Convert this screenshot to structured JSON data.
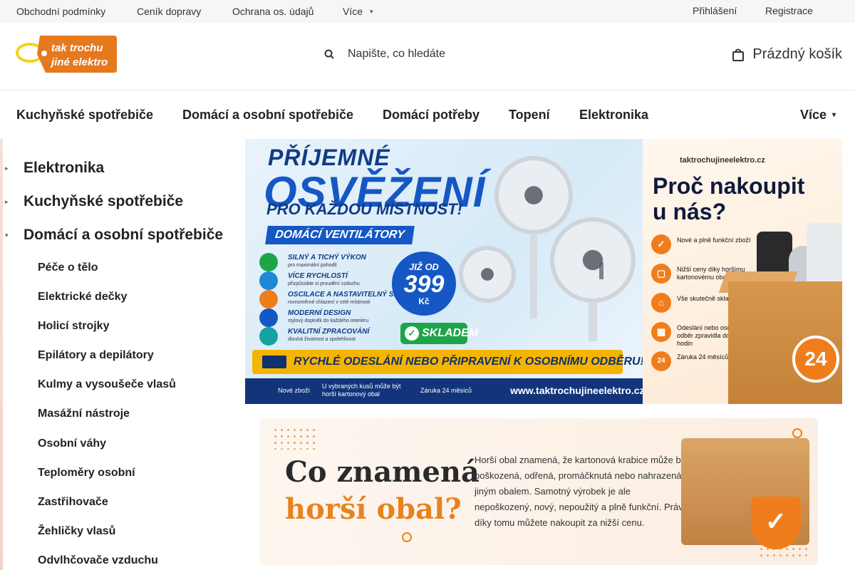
{
  "topbar": {
    "links": [
      "Obchodní podmínky",
      "Ceník dopravy",
      "Ochrana os. údajů",
      "Více"
    ],
    "login": "Přihlášení",
    "register": "Registrace"
  },
  "header": {
    "logo_line1": "tak trochu",
    "logo_line2": "jiné elektro",
    "search_placeholder": "Napište, co hledáte",
    "cart_label": "Prázdný košík"
  },
  "mainnav": {
    "items": [
      "Kuchyňské spotřebiče",
      "Domácí a osobní spotřebiče",
      "Domácí potřeby",
      "Topení",
      "Elektronika"
    ],
    "more": "Více"
  },
  "sidebar": {
    "categories": [
      "Elektronika",
      "Kuchyňské spotřebiče",
      "Domácí a osobní spotřebiče"
    ],
    "subcategories": [
      "Péče o tělo",
      "Elektrické dečky",
      "Holicí strojky",
      "Epilátory a depilátory",
      "Kulmy a vysoušeče vlasů",
      "Masážní nástroje",
      "Osobní váhy",
      "Teploměry osobní",
      "Zastřihovače",
      "Žehličky vlasů",
      "Odvlhčovače vzduchu"
    ]
  },
  "banner_fans": {
    "title1": "PŘÍJEMNÉ",
    "title2": "OSVĚŽENÍ",
    "title3": "PRO KAŽDOU MÍSTNOST!",
    "tag": "DOMÁCÍ VENTILÁTORY",
    "features": [
      {
        "title": "SILNÝ A TICHÝ VÝKON",
        "sub": "pro maximální pohodlí",
        "color": "#1ea44a"
      },
      {
        "title": "VÍCE RYCHLOSTÍ",
        "sub": "přizpůsobte si proudění vzduchu",
        "color": "#1e88d8"
      },
      {
        "title": "OSCILACE A NASTAVITELNÝ SKLON",
        "sub": "rovnoměrné chlazení v celé místnosti",
        "color": "#f07d1c"
      },
      {
        "title": "MODERNÍ DESIGN",
        "sub": "stylový doplněk do každého interiéru",
        "color": "#1557c4"
      },
      {
        "title": "KVALITNÍ ZPRACOVÁNÍ",
        "sub": "dlouhá životnost a spolehlivost",
        "color": "#17a2a2"
      }
    ],
    "price_prefix": "JIŽ OD",
    "price": "399",
    "price_unit": "Kč",
    "stock": "SKLADEM",
    "shipping": "RYCHLÉ ODESLÁNÍ NEBO PŘIPRAVENÍ K OSOBNÍMU ODBĚRU!",
    "foot_new": "Nové zboží",
    "foot_box": "U vybraných kusů může být horší kartonový obal",
    "foot_warranty": "Záruka 24 měsíců",
    "foot_web": "www.taktrochujineelektro.cz"
  },
  "banner_why": {
    "brand": "taktrochujineelektro.cz",
    "title_line1": "Proč nakoupit",
    "title_line2": "u nás?",
    "rows": [
      "Nové a plně funkční zboží",
      "Nižší ceny díky horšímu kartonovému obalu",
      "Vše skutečně skladem",
      "Odeslání nebo osobní odběr zpravidla do 24 hodin",
      "Záruka 24 měsíců"
    ],
    "badge": "24"
  },
  "banner_box": {
    "title_line1": "Co znamená",
    "title_line2": "horší obal?",
    "text": "Horší obal znamená, že kartonová krabice může být poškozená, odřená, promáčknutá nebo nahrazená jiným obalem. Samotný výrobek je ale nepoškozený, nový, nepoužitý a plně funkční. Právě díky tomu můžete nakoupit za nižší cenu."
  },
  "colors": {
    "accent_orange": "#f07d1c",
    "brand_blue": "#1557c4",
    "logo_yellow": "#f4d21f",
    "logo_orange": "#e6781e"
  }
}
